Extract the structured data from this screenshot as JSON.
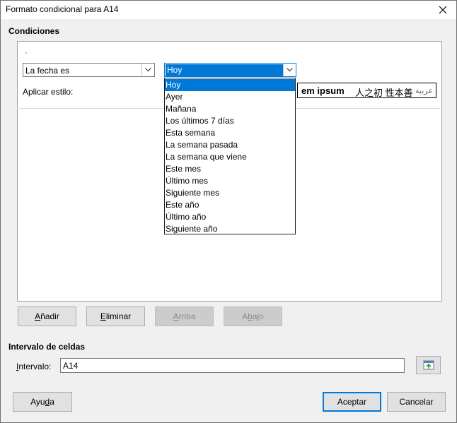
{
  "window": {
    "title": "Formato condicional para A14"
  },
  "conditions": {
    "heading": "Condiciones",
    "condition_type": "La fecha es",
    "date_value": "Hoy",
    "apply_style_label": "Aplicar estilo:",
    "preview": {
      "latin": "em ipsum",
      "cjk": "人之初 性本善",
      "arabic": "ة عربية"
    },
    "dropdown_options": [
      "Hoy",
      "Ayer",
      "Mañana",
      "Los últimos 7 días",
      "Esta semana",
      "La semana pasada",
      "La semana que viene",
      "Este mes",
      "Último mes",
      "Siguiente mes",
      "Este año",
      "Último año",
      "Siguiente año"
    ],
    "selected_option_index": 0
  },
  "condition_buttons": {
    "add": {
      "pre": "",
      "key": "A",
      "post": "ñadir"
    },
    "delete": {
      "pre": "",
      "key": "E",
      "post": "liminar"
    },
    "up": {
      "pre": "",
      "key": "A",
      "post": "rriba"
    },
    "down": {
      "pre": "A",
      "key": "b",
      "post": "ajo"
    }
  },
  "range": {
    "heading": "Intervalo de celdas",
    "label": {
      "pre": "",
      "key": "I",
      "post": "ntervalo:"
    },
    "value": "A14"
  },
  "footer": {
    "help": {
      "pre": "Ayu",
      "key": "d",
      "post": "a"
    },
    "ok": "Aceptar",
    "cancel": "Cancelar"
  },
  "icons": {
    "close": "close-icon",
    "chevron": "chevron-down-icon",
    "shrink": "shrink-dialog-icon"
  }
}
